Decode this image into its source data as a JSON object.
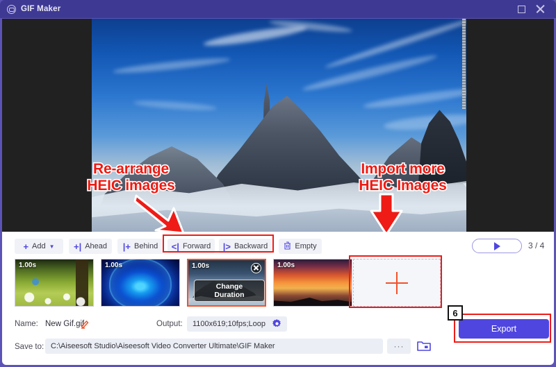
{
  "window": {
    "title": "GIF Maker",
    "logo_icon": "gif-maker-logo-icon",
    "maximize_icon": "maximize-icon",
    "close_icon": "close-icon"
  },
  "preview": {
    "description": "Snowy mountain peak under blue sky",
    "ruler_icon": "ruler-icon"
  },
  "annotations": [
    {
      "id": "rearrange",
      "text": "Re-arrange\nHEIC images",
      "color": "#f01a12",
      "arrow": "down-right-arrow"
    },
    {
      "id": "import-more",
      "text": "Import more\nHEIC Images",
      "color": "#f01a12",
      "arrow": "down-arrow"
    }
  ],
  "toolbar": {
    "add": {
      "label": "Add",
      "icon": "plus-icon",
      "caret": "▼"
    },
    "ahead": {
      "label": "Ahead",
      "icon": "insert-ahead-icon"
    },
    "behind": {
      "label": "Behind",
      "icon": "insert-behind-icon"
    },
    "forward": {
      "label": "Forward",
      "icon": "move-forward-icon"
    },
    "backward": {
      "label": "Backward",
      "icon": "move-backward-icon"
    },
    "empty": {
      "label": "Empty",
      "icon": "trash-icon"
    },
    "play": {
      "icon": "play-icon"
    },
    "counter": "3 / 4"
  },
  "thumbnails": [
    {
      "duration": "1.00s",
      "image": "bird-on-grass",
      "selected": false
    },
    {
      "duration": "1.00s",
      "image": "blue-lotus",
      "selected": false
    },
    {
      "duration": "1.00s",
      "image": "snowy-mountain",
      "selected": true,
      "change_duration_label": "Change Duration",
      "close_icon": "close-icon"
    },
    {
      "duration": "1.00s",
      "image": "sunset-landscape",
      "selected": false
    }
  ],
  "dropzone": {
    "plus_icon": "plus-icon",
    "accent_color": "#f2512a"
  },
  "settings": {
    "name_label": "Name:",
    "name_value": "New Gif.gif",
    "edit_icon": "pencil-icon",
    "output_label": "Output:",
    "output_value": "1100x619;10fps;Loop",
    "gear_icon": "gear-icon",
    "save_label": "Save to:",
    "save_path": "C:\\Aiseesoft Studio\\Aiseesoft Video Converter Ultimate\\GIF Maker",
    "browse_label": "···",
    "folder_icon": "folder-icon"
  },
  "export": {
    "label": "Export",
    "accent_color": "#4f46e0",
    "step_badge": "6"
  },
  "highlights": {
    "color": "#ee1b17",
    "regions": [
      "move-buttons",
      "add-media-dropzone",
      "export-button"
    ]
  }
}
